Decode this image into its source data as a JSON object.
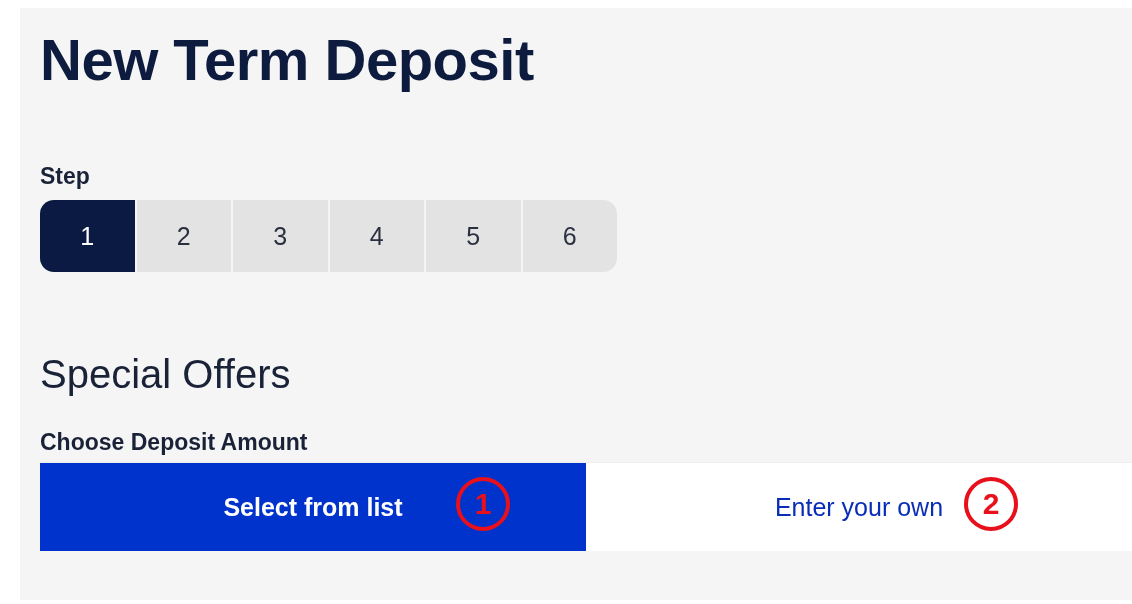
{
  "title": "New Term Deposit",
  "steps": {
    "label": "Step",
    "items": [
      {
        "label": "1",
        "selected": true
      },
      {
        "label": "2",
        "selected": false
      },
      {
        "label": "3",
        "selected": false
      },
      {
        "label": "4",
        "selected": false
      },
      {
        "label": "5",
        "selected": false
      },
      {
        "label": "6",
        "selected": false
      }
    ]
  },
  "section_title": "Special Offers",
  "deposit_amount": {
    "label": "Choose Deposit Amount",
    "options": [
      {
        "label": "Select from list",
        "selected": true,
        "annotation": "1"
      },
      {
        "label": "Enter your own",
        "selected": false,
        "annotation": "2"
      }
    ]
  }
}
